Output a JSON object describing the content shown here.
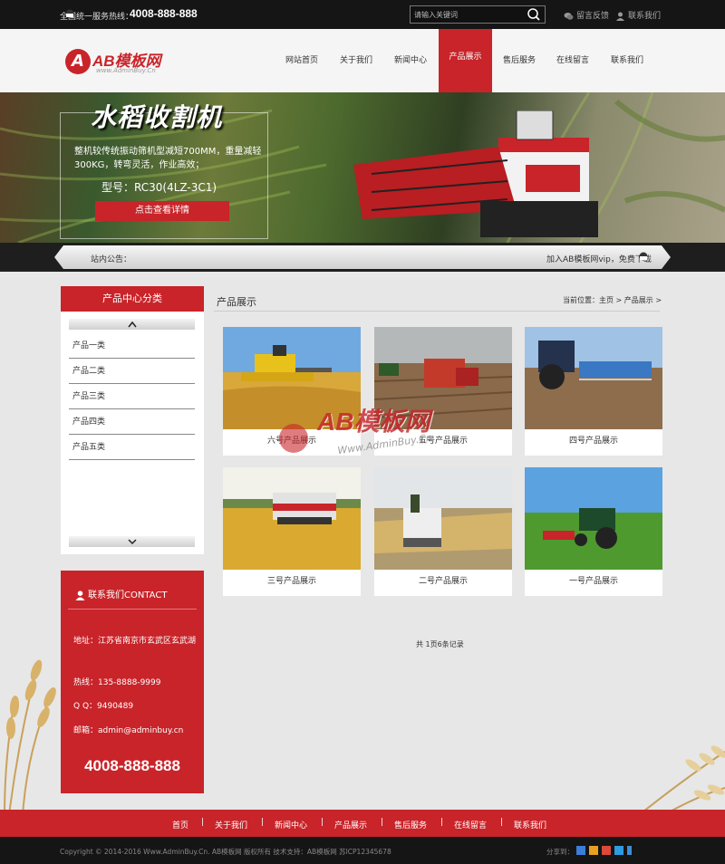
{
  "topbar": {
    "hotline_label": "全国统一服务热线：",
    "hotline": "4008-888-888",
    "search_placeholder": "请输入关键词",
    "feedback": "留言反馈",
    "contact": "联系我们"
  },
  "header": {
    "logo_text": "AB模板网",
    "logo_sub": "www.AdminBuy.Cn",
    "logo_mark": "A",
    "nav": [
      "网站首页",
      "关于我们",
      "新闻中心",
      "产品展示",
      "售后服务",
      "在线留言",
      "联系我们"
    ],
    "active_nav": "产品展示"
  },
  "banner": {
    "title": "水稻收割机",
    "desc": "整机较传统振动筛机型减短700MM，重量减轻300KG，转弯灵活，作业高效；",
    "model": "型号：RC30(4LZ-3C1)",
    "button": "点击查看详情"
  },
  "notice": {
    "label": "站内公告：",
    "message": "加入AB模板网vip，免费下载"
  },
  "sidebar": {
    "category_title": "产品中心分类",
    "categories": [
      "产品一类",
      "产品二类",
      "产品三类",
      "产品四类",
      "产品五类"
    ],
    "contact_title": "联系我们CONTACT",
    "address": "地址：江苏省南京市玄武区玄武湖",
    "phone_line": "热线：135-8888-9999",
    "qq": "Q Q：9490489",
    "email": "邮箱：admin@adminbuy.cn",
    "phone_big": "4008-888-888"
  },
  "main": {
    "title": "产品展示",
    "breadcrumb": "当前位置：主页 > 产品展示 >",
    "products": [
      "六号产品展示",
      "五号产品展示",
      "四号产品展示",
      "三号产品展示",
      "二号产品展示",
      "一号产品展示"
    ],
    "pager": "共 1页6条记录"
  },
  "watermark": {
    "text": "AB模板网",
    "url": "Www.AdminBuy.Cn"
  },
  "footer": {
    "nav": [
      "首页",
      "关于我们",
      "新闻中心",
      "产品展示",
      "售后服务",
      "在线留言",
      "联系我们"
    ],
    "copyright": "Copyright © 2014-2016 Www.AdminBuy.Cn. AB模板网 版权所有  技术支持：AB模板网  苏ICP12345678",
    "share_label": "分享到：",
    "share_colors": [
      "#3b7ed8",
      "#e8a020",
      "#d94a3a",
      "#2c9be0",
      "#3a8fd8"
    ]
  },
  "colors": {
    "accent": "#c8242a",
    "dark": "#151515"
  }
}
